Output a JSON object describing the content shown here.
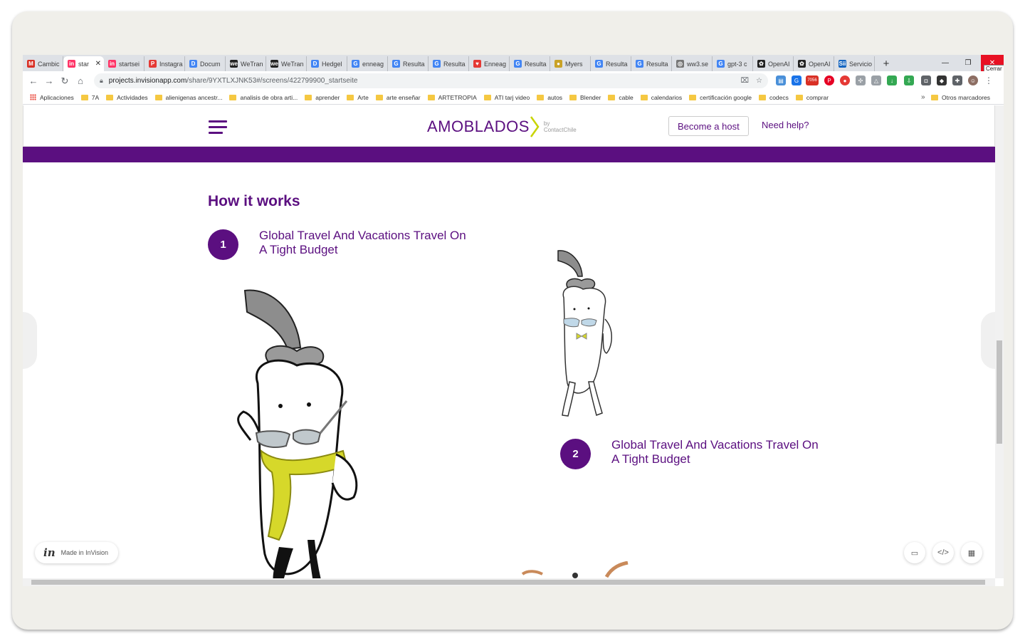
{
  "browser": {
    "tabs": [
      {
        "label": "Cambic",
        "fav": "M",
        "color": "#d93025"
      },
      {
        "label": "star",
        "fav": "in",
        "color": "#ff3366",
        "active": true
      },
      {
        "label": "startsei",
        "fav": "in",
        "color": "#ff3366"
      },
      {
        "label": "Instagra",
        "fav": "P",
        "color": "#e53935"
      },
      {
        "label": "Docum",
        "fav": "D",
        "color": "#4285f4"
      },
      {
        "label": "WeTran",
        "fav": "we",
        "color": "#222222"
      },
      {
        "label": "WeTran",
        "fav": "we",
        "color": "#222222"
      },
      {
        "label": "Hedgel",
        "fav": "D",
        "color": "#4285f4"
      },
      {
        "label": "enneag",
        "fav": "G",
        "color": "#4285f4"
      },
      {
        "label": "Resulta",
        "fav": "G",
        "color": "#4285f4"
      },
      {
        "label": "Resulta",
        "fav": "G",
        "color": "#4285f4"
      },
      {
        "label": "Enneag",
        "fav": "♥",
        "color": "#e53935"
      },
      {
        "label": "Resulta",
        "fav": "G",
        "color": "#4285f4"
      },
      {
        "label": "Myers",
        "fav": "●",
        "color": "#c9a227"
      },
      {
        "label": "Resulta",
        "fav": "G",
        "color": "#4285f4"
      },
      {
        "label": "Resulta",
        "fav": "G",
        "color": "#4285f4"
      },
      {
        "label": "ww3.se",
        "fav": "◎",
        "color": "#777777"
      },
      {
        "label": "gpt-3 c",
        "fav": "G",
        "color": "#4285f4"
      },
      {
        "label": "OpenAI",
        "fav": "✿",
        "color": "#222222"
      },
      {
        "label": "OpenAI",
        "fav": "✿",
        "color": "#222222"
      },
      {
        "label": "Servicio",
        "fav": "Sii",
        "color": "#1565c0"
      }
    ],
    "new_tab": "+",
    "tooltip": "Cerrar",
    "url_host": "projects.invisionapp.com",
    "url_path": "/share/9YXTLXJNK53#/screens/422799900_startseite",
    "bookmarks": [
      "Aplicaciones",
      "7A",
      "Actividades",
      "alienigenas ancestr...",
      "analisis de obra arti...",
      "aprender",
      "Arte",
      "arte enseñar",
      "ARTETROPIA",
      "ATI tarj video",
      "autos",
      "Blender",
      "cable",
      "calendarios",
      "certificación google",
      "codecs",
      "comprar"
    ],
    "more_bookmarks": "»",
    "other_bookmarks": "Otros marcadores",
    "ext_badge": "7056"
  },
  "site": {
    "logo": "AMOBLADOS",
    "logo_by": "by",
    "logo_sub": "ContactChile",
    "become_host": "Become a host",
    "need_help": "Need help?",
    "section_title": "How it works",
    "steps": [
      {
        "num": "1",
        "text": "Global Travel And Vacations  Travel On A Tight Budget"
      },
      {
        "num": "2",
        "text": "Global Travel And Vacations  Travel On A Tight Budget"
      }
    ],
    "brand_color": "#5b0f80"
  },
  "invision": {
    "made_in": "Made in InVision",
    "logo": "in"
  }
}
